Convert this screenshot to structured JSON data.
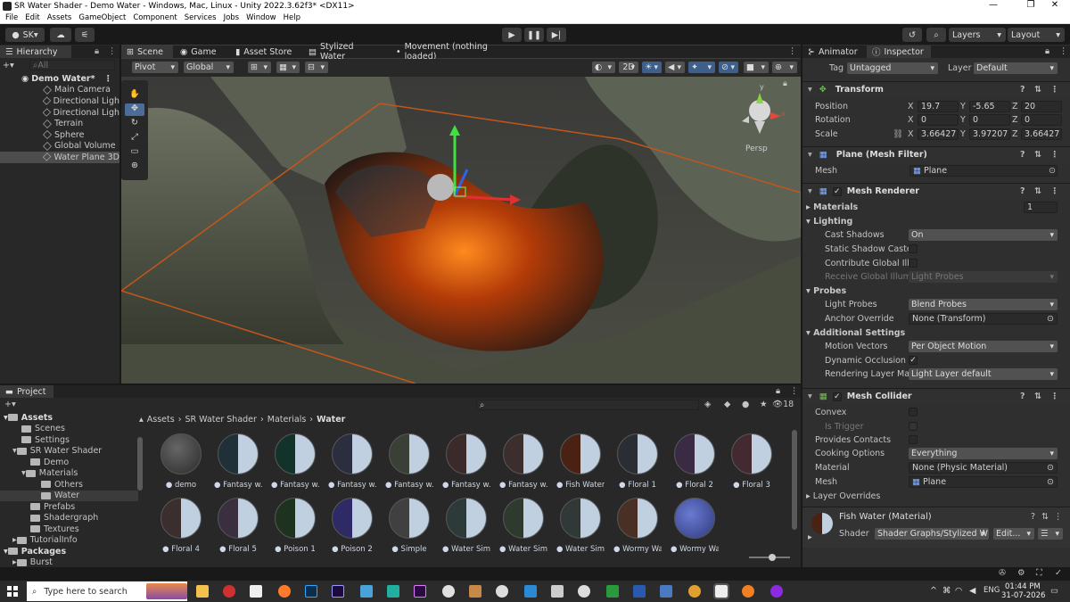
{
  "window": {
    "title": "SR Water Shader - Demo Water - Windows, Mac, Linux - Unity 2022.3.62f3* <DX11>",
    "minimize": "—",
    "maximize": "❐",
    "close": "✕"
  },
  "menu": [
    "File",
    "Edit",
    "Assets",
    "GameObject",
    "Component",
    "Services",
    "Jobs",
    "Window",
    "Help"
  ],
  "toolbar": {
    "account": "SK",
    "layers": "Layers",
    "layout": "Layout"
  },
  "hierarchy": {
    "tab": "Hierarchy",
    "search_placeholder": "All",
    "scene": "Demo Water*",
    "items": [
      "Main Camera",
      "Directional Ligh",
      "Directional Ligh",
      "Terrain",
      "Sphere",
      "Global Volume",
      "Water Plane 3D"
    ]
  },
  "scene_tabs": [
    "Scene",
    "Game",
    "Asset Store",
    "Stylized Water",
    "Movement (nothing loaded)"
  ],
  "scene_toolbar": {
    "pivot": "Pivot",
    "global": "Global",
    "mode2d": "2D",
    "persp": "Persp"
  },
  "inspector": {
    "tabs": [
      "Animator",
      "Inspector"
    ],
    "tag_label": "Tag",
    "tag": "Untagged",
    "layer_label": "Layer",
    "layer": "Default",
    "transform": {
      "title": "Transform",
      "pos_label": "Position",
      "rot_label": "Rotation",
      "scale_label": "Scale",
      "position": [
        "19.7",
        "-5.65",
        "20"
      ],
      "rotation": [
        "0",
        "0",
        "0"
      ],
      "scale": [
        "3.66427",
        "3.97207",
        "3.66427"
      ],
      "axes": [
        "X",
        "Y",
        "Z"
      ]
    },
    "mesh_filter": {
      "title": "Plane (Mesh Filter)",
      "mesh_label": "Mesh",
      "mesh": "Plane"
    },
    "mesh_renderer": {
      "title": "Mesh Renderer",
      "materials": "Materials",
      "materials_count": "1",
      "lighting": "Lighting",
      "cast_shadows_label": "Cast Shadows",
      "cast_shadows": "On",
      "static_shadow": "Static Shadow Caste",
      "contribute_gi": "Contribute Global Illu",
      "receive_gi": "Receive Global Illum",
      "receive_gi_value": "Light Probes",
      "probes": "Probes",
      "light_probes_label": "Light Probes",
      "light_probes": "Blend Probes",
      "anchor_label": "Anchor Override",
      "anchor": "None (Transform)",
      "additional": "Additional Settings",
      "motion_label": "Motion Vectors",
      "motion": "Per Object Motion",
      "occlusion": "Dynamic Occlusion",
      "rlm_label": "Rendering Layer Ma:",
      "rlm": "Light Layer default"
    },
    "mesh_collider": {
      "title": "Mesh Collider",
      "convex": "Convex",
      "trigger": "Is Trigger",
      "contacts": "Provides Contacts",
      "cooking_label": "Cooking Options",
      "cooking": "Everything",
      "material_label": "Material",
      "material": "None (Physic Material)",
      "mesh_label": "Mesh",
      "mesh": "Plane",
      "overrides": "Layer Overrides"
    },
    "material": {
      "title": "Fish Water (Material)",
      "shader_label": "Shader",
      "shader": "Shader Graphs/Stylized W",
      "edit": "Edit..."
    }
  },
  "project": {
    "tab": "Project",
    "count": "18",
    "tree": [
      "Assets",
      "Scenes",
      "Settings",
      "SR Water Shader",
      "Demo",
      "Materials",
      "Others",
      "Water",
      "Prefabs",
      "Shadergraph",
      "Textures",
      "TutorialInfo",
      "Packages",
      "Burst"
    ],
    "breadcrumb": [
      "Assets",
      "SR Water Shader",
      "Materials",
      "Water"
    ],
    "assets": [
      "demo",
      "Fantasy w...",
      "Fantasy w...",
      "Fantasy w...",
      "Fantasy w...",
      "Fantasy w...",
      "Fantasy w...",
      "Fish Water",
      "Floral 1",
      "Floral 2",
      "Floral 3",
      "Floral 4",
      "Floral 5",
      "Poison 1",
      "Poison 2",
      "Simple",
      "Water Simp...",
      "Water Simp...",
      "Water Simp...",
      "Wormy Wa...",
      "Wormy Wa..."
    ]
  },
  "taskbar": {
    "search_placeholder": "Type here to search",
    "lang": "ENG",
    "time": "01:44 PM",
    "date": "31-07-2026"
  }
}
